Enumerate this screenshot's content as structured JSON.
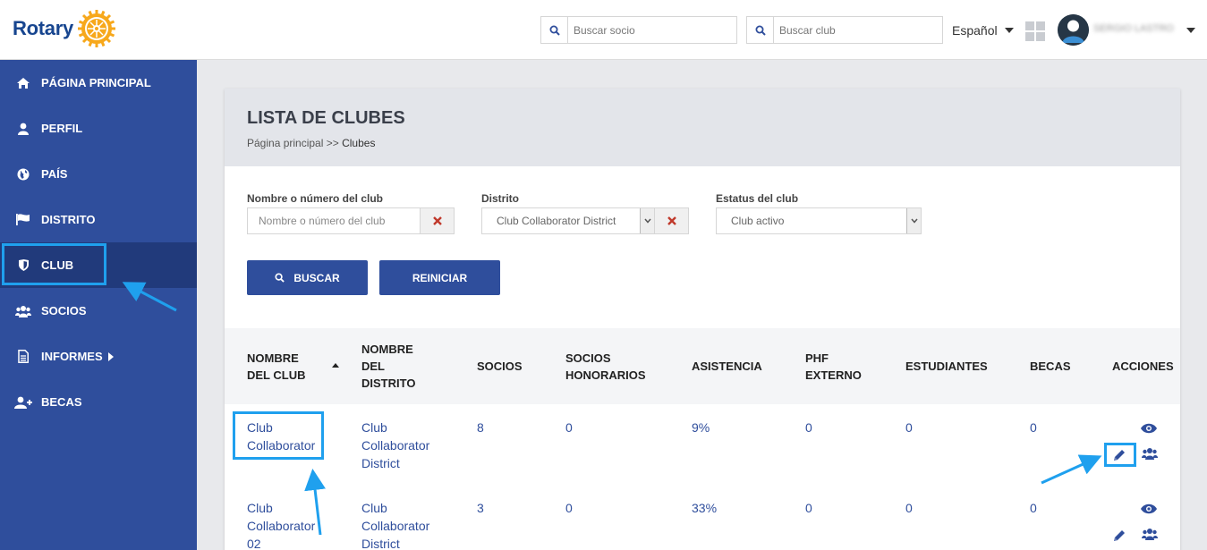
{
  "header": {
    "brand": "Rotary",
    "search_member_placeholder": "Buscar socio",
    "search_club_placeholder": "Buscar club",
    "language": "Español",
    "user_name": "SERGIO LASTRO"
  },
  "sidebar": {
    "items": [
      {
        "label": "PÁGINA PRINCIPAL",
        "icon": "home-icon"
      },
      {
        "label": "PERFIL",
        "icon": "user-icon"
      },
      {
        "label": "PAÍS",
        "icon": "globe-icon"
      },
      {
        "label": "DISTRITO",
        "icon": "flag-icon"
      },
      {
        "label": "CLUB",
        "icon": "shield-icon",
        "active": true
      },
      {
        "label": "SOCIOS",
        "icon": "users-icon"
      },
      {
        "label": "INFORMES",
        "icon": "document-icon"
      },
      {
        "label": "BECAS",
        "icon": "user-plus-icon"
      }
    ]
  },
  "page": {
    "title": "LISTA DE CLUBES",
    "breadcrumb_home": "Página principal",
    "breadcrumb_sep": ">>",
    "breadcrumb_current": "Clubes"
  },
  "filters": {
    "club_label": "Nombre o número del club",
    "club_placeholder": "Nombre o número del club",
    "district_label": "Distrito",
    "district_value": "Club Collaborator District",
    "status_label": "Estatus del club",
    "status_value": "Club activo"
  },
  "buttons": {
    "search": "BUSCAR",
    "reset": "REINICIAR"
  },
  "table": {
    "headers": {
      "club_l1": "NOMBRE",
      "club_l2": "DEL CLUB",
      "dist_l1": "NOMBRE",
      "dist_l2": "DEL",
      "dist_l3": "DISTRITO",
      "members": "SOCIOS",
      "hon_l1": "SOCIOS",
      "hon_l2": "HONORARIOS",
      "attendance": "ASISTENCIA",
      "phf_l1": "PHF",
      "phf_l2": "EXTERNO",
      "students": "ESTUDIANTES",
      "grants": "BECAS",
      "actions": "ACCIONES"
    },
    "rows": [
      {
        "club_l1": "Club",
        "club_l2": "Collaborator",
        "club_l3": "",
        "dist_l1": "Club",
        "dist_l2": "Collaborator",
        "dist_l3": "District",
        "members": "8",
        "honorary": "0",
        "attendance": "9%",
        "phf": "0",
        "students": "0",
        "grants": "0"
      },
      {
        "club_l1": "Club",
        "club_l2": "Collaborator",
        "club_l3": "02",
        "dist_l1": "Club",
        "dist_l2": "Collaborator",
        "dist_l3": "District",
        "members": "3",
        "honorary": "0",
        "attendance": "33%",
        "phf": "0",
        "students": "0",
        "grants": "0"
      }
    ]
  },
  "colors": {
    "brand_blue": "#17458f",
    "sidebar": "#2f4e9c",
    "sidebar_active": "#213a7b",
    "highlight": "#1fa0ee",
    "gold": "#f7a81b"
  }
}
